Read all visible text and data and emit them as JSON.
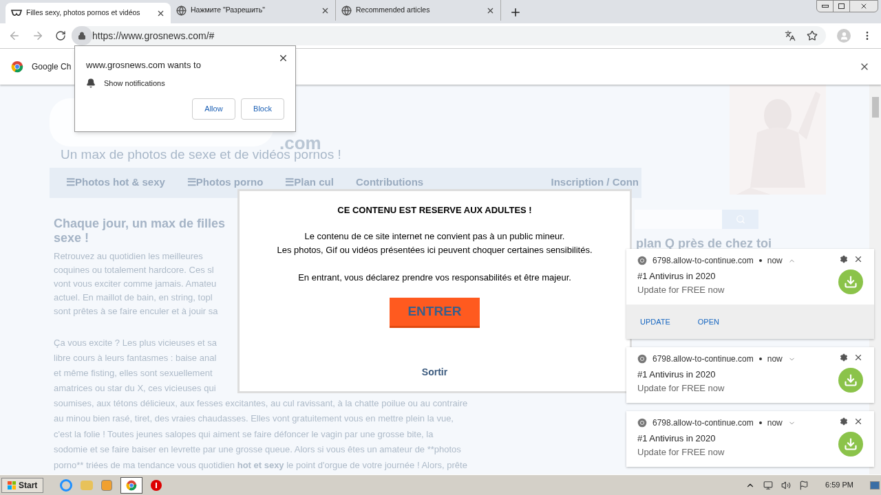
{
  "tabs": [
    {
      "title": "Filles sexy, photos pornos et vidéos",
      "selected": true
    },
    {
      "title": "Нажмите \"Разрешить\"",
      "selected": false
    },
    {
      "title": "Recommended articles",
      "selected": false
    }
  ],
  "address": "https://www.grosnews.com/#",
  "infobar": {
    "text": "Google Ch"
  },
  "permission": {
    "title": "www.grosnews.com wants to",
    "item": "Show notifications",
    "buttons": [
      "Allow",
      "Block"
    ]
  },
  "site": {
    "logo": ".com",
    "tagline": "Un max de photos de sexe et de vidéos pornos !",
    "nav": [
      "☰Photos hot & sexy",
      "☰Photos porno",
      "☰Plan cul",
      "Contributions"
    ],
    "login": "Inscription / Conn",
    "heading": "Chaque jour, un max de filles",
    "heading2": "sexe !",
    "side_heading": "plan Q près de chez toi",
    "para1": [
      "Retrouvez au quotidien les meilleures",
      "coquines ou totalement hardcore. Ces sl",
      "vont vous exciter comme jamais. Amateu",
      "actuel. En maillot de bain, en string, topl",
      "sont prêtes à se faire enculer et à jouir sa"
    ],
    "para2": [
      "Ça vous excite ? Les plus vicieuses et sa",
      "libre cours à leurs fantasmes : baise anal",
      "et même fisting, elles sont sexuellement",
      "amatrices ou star du X, ces vicieuses qui"
    ],
    "para3": [
      "soumises, aux tétons délicieux, aux fesses excitantes, au cul ravissant, à la chatte poilue ou au contraire",
      "au minou bien rasé, tiret, des vraies chaudasses. Elles vont gratuitement vous en mettre plein la vue,",
      "c'est la folie ! Toutes jeunes salopes qui aiment se faire défoncer le vagin par une grosse bite, la",
      "sodomie et se faire baiser en levrette par une grosse queue. Alors si vous êtes un amateur de **photos",
      "porno** triées de ma tendance vous quotidien **hot et sexy** le point d'orgue de votre journée ! Alors, prête"
    ]
  },
  "modal": {
    "title": "CE CONTENU EST RESERVE AUX ADULTES !",
    "lines": [
      "Le contenu de ce site internet ne convient pas à un public mineur.",
      "Les photos, Gif ou vidéos présentées ici peuvent choquer certaines sensibilités.",
      "En entrant, vous déclarez prendre vos responsabilités et être majeur."
    ],
    "enter": "ENTRER",
    "exit": "Sortir"
  },
  "notifications": [
    {
      "source": "6798.allow-to-continue.com",
      "time": "now",
      "expanded": true,
      "title": "#1 Antivirus in 2020",
      "body": "Update for FREE now",
      "actions": [
        "UPDATE",
        "OPEN"
      ]
    },
    {
      "source": "6798.allow-to-continue.com",
      "time": "now",
      "expanded": false,
      "title": "#1 Antivirus in 2020",
      "body": "Update for FREE now"
    },
    {
      "source": "6798.allow-to-continue.com",
      "time": "now",
      "expanded": false,
      "title": "#1 Antivirus in 2020",
      "body": "Update for FREE now"
    }
  ],
  "taskbar": {
    "start": "Start",
    "clock": "6:59 PM"
  }
}
